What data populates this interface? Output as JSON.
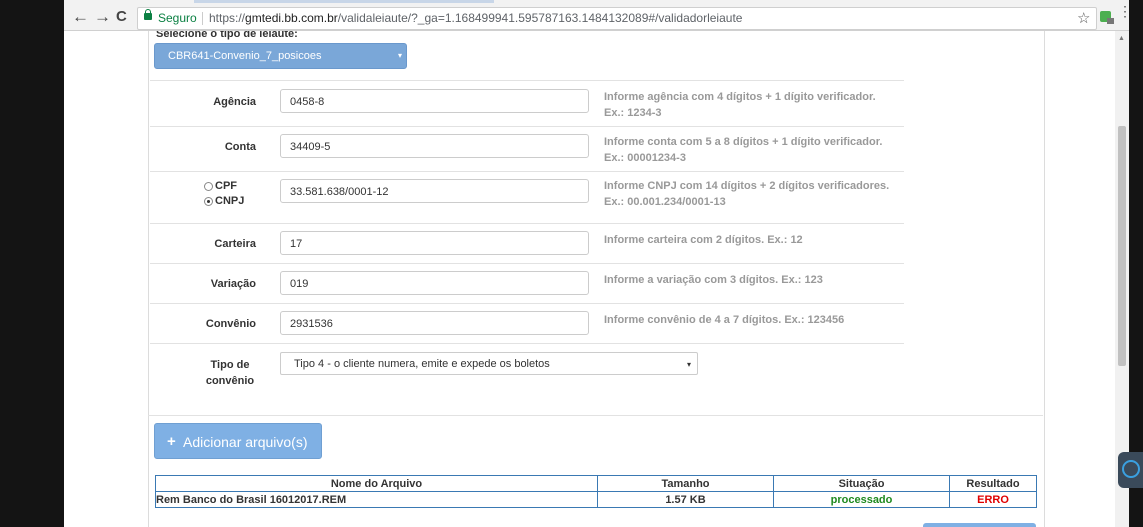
{
  "browser": {
    "secure_label": "Seguro",
    "url_scheme": "https://",
    "url_host": "gmtedi.bb.com.br",
    "url_rest": "/validaleiaute/?_ga=1.168499941.595787163.1484132089#/validadorleiaute",
    "back_icon": "←",
    "forward_icon": "→",
    "reload_icon": "C",
    "star_icon": "☆",
    "menu_icon": "⋮"
  },
  "layout": {
    "label": "Selecione o tipo de leiaute:",
    "selected": "CBR641-Convenio_7_posicoes",
    "caret": "▾"
  },
  "form": {
    "agencia": {
      "label": "Agência",
      "value": "0458-8",
      "help1": "Informe agência com 4 dígitos + 1 dígito verificador.",
      "help2": "Ex.: 1234-3"
    },
    "conta": {
      "label": "Conta",
      "value": "34409-5",
      "help1": "Informe conta com 5 a 8 dígitos + 1 dígito verificador.",
      "help2": "Ex.: 00001234-3"
    },
    "doc": {
      "cpf_label": "CPF",
      "cnpj_label": "CNPJ",
      "selected": "CNPJ",
      "value": "33.581.638/0001-12",
      "help1": "Informe CNPJ com 14 dígitos + 2 dígitos verificadores.",
      "help2": "Ex.: 00.001.234/0001-13"
    },
    "carteira": {
      "label": "Carteira",
      "value": "17",
      "help1": "Informe carteira com 2 dígitos. Ex.: 12"
    },
    "variacao": {
      "label": "Variação",
      "value": "019",
      "help1": "Informe a variação com 3 dígitos. Ex.: 123"
    },
    "convenio": {
      "label": "Convênio",
      "value": "2931536",
      "help1": "Informe convênio de 4 a 7 dígitos. Ex.: 123456"
    },
    "tipo": {
      "label_line1": "Tipo de",
      "label_line2": "convênio",
      "selected": "Tipo 4 - o cliente numera, emite e expede os boletos",
      "caret": "▾"
    }
  },
  "add_button": {
    "icon": "+",
    "label": "Adicionar arquivo(s)"
  },
  "files_table": {
    "headers": [
      "Nome do Arquivo",
      "Tamanho",
      "Situação",
      "Resultado"
    ],
    "rows": [
      {
        "name": "Rem Banco do Brasil 16012017.REM",
        "size": "1.57 KB",
        "status": "processado",
        "result": "ERRO"
      }
    ]
  },
  "colors": {
    "accent": "#7aa7d8",
    "ok": "#1f8a1f",
    "error": "#e00000",
    "table_border": "#3a79b3"
  }
}
